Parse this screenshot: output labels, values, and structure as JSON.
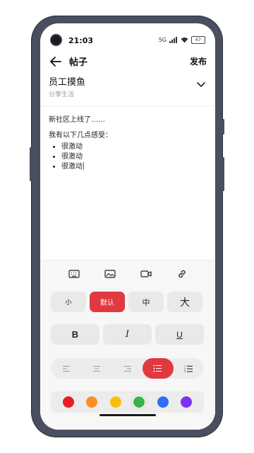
{
  "status_bar": {
    "time": "21:03",
    "network": "5G",
    "battery": "67"
  },
  "app_bar": {
    "title": "帖子",
    "publish_label": "发布"
  },
  "group": {
    "name": "员工摸鱼",
    "subtitle": "分享生活"
  },
  "content": {
    "line1": "新社区上线了……",
    "line2": "我有以下几点感受：",
    "bullets": [
      "很激动",
      "很激动",
      "很激动"
    ]
  },
  "toolbar": {
    "icons": [
      "keyboard-icon",
      "image-icon",
      "video-icon",
      "link-icon"
    ],
    "sizes": [
      {
        "label": "小",
        "active": false
      },
      {
        "label": "默认",
        "active": true
      },
      {
        "label": "中",
        "active": false
      },
      {
        "label": "大",
        "active": false
      }
    ],
    "formats": {
      "bold": "B",
      "italic": "I",
      "underline": "U"
    },
    "align": [
      "align-left-icon",
      "align-center-icon",
      "align-right-icon",
      "bullet-list-icon",
      "numbered-list-icon"
    ],
    "active_align": "bullet-list-icon",
    "colors": [
      "#ea1c1f",
      "#fb8d27",
      "#fbbe0f",
      "#3bb24b",
      "#2f6ef5",
      "#7b35f2"
    ],
    "selected_color": "#3bb24b"
  },
  "accent_color": "#e0393f"
}
